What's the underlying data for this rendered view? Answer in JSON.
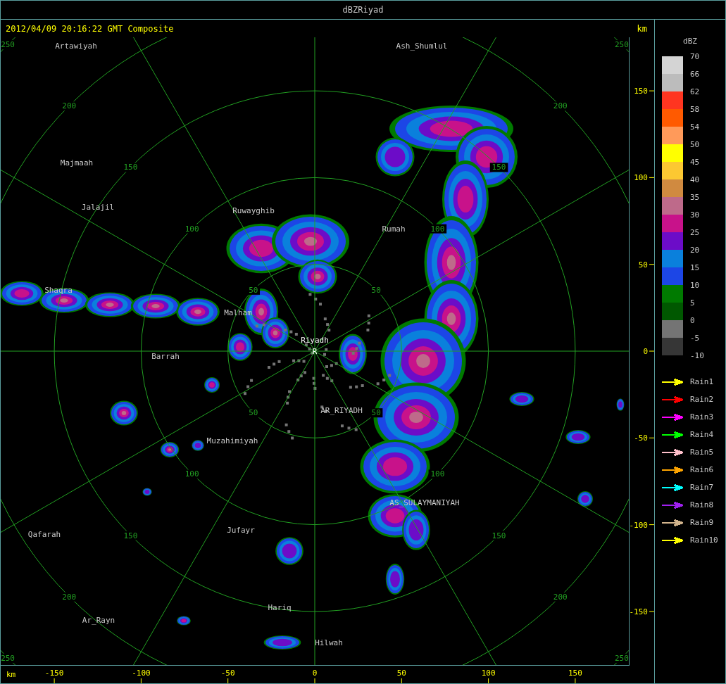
{
  "window": {
    "title": "dBZRiyad"
  },
  "header": {
    "timestamp": "2012/04/09 20:16:22 GMT Composite",
    "unit": "km"
  },
  "map": {
    "center_label": "Riyadh",
    "center_mark": "R",
    "places": [
      "Artawiyah",
      "Ash_Shumlul",
      "Majmaah",
      "Jalajil",
      "Ruwayghib",
      "Rumah",
      "Shaqra",
      "Malham",
      "Barrah",
      "AR_RIYADH",
      "Muzahimiyah",
      "AS_SULAYMANIYAH",
      "Qafarah",
      "Jufayr",
      "Hariq",
      "Ar_Rayn",
      "Hilwah"
    ],
    "ring_labels": [
      "50",
      "50",
      "50",
      "50",
      "100",
      "100",
      "100",
      "100",
      "150",
      "150",
      "150",
      "150",
      "200",
      "200",
      "200",
      "200",
      "250",
      "250",
      "250",
      "250"
    ]
  },
  "x_axis": {
    "unit": "km",
    "ticks": [
      "-150",
      "-100",
      "-50",
      "0",
      "50",
      "100",
      "150"
    ]
  },
  "y_axis": {
    "ticks": [
      "150",
      "100",
      "50",
      "0",
      "-50",
      "-100",
      "-150"
    ]
  },
  "legend": {
    "unit": "dBZ",
    "bottom_label": "-10",
    "bands": [
      {
        "label": "70",
        "color": "#d4d4d4"
      },
      {
        "label": "66",
        "color": "#bcbcbc"
      },
      {
        "label": "62",
        "color": "#ff3520"
      },
      {
        "label": "58",
        "color": "#ff5a00"
      },
      {
        "label": "54",
        "color": "#ff9a5a"
      },
      {
        "label": "50",
        "color": "#ffff00"
      },
      {
        "label": "45",
        "color": "#fcc832"
      },
      {
        "label": "40",
        "color": "#d08a40"
      },
      {
        "label": "35",
        "color": "#be6a8a"
      },
      {
        "label": "30",
        "color": "#c8128a"
      },
      {
        "label": "25",
        "color": "#6c0cc8"
      },
      {
        "label": "20",
        "color": "#0a80dc"
      },
      {
        "label": "15",
        "color": "#1c46e6"
      },
      {
        "label": "10",
        "color": "#007a00"
      },
      {
        "label": "5",
        "color": "#005800"
      },
      {
        "label": "0",
        "color": "#747474"
      },
      {
        "label": "-5",
        "color": "#363636"
      }
    ]
  },
  "tracks": [
    {
      "label": "Rain1",
      "color": "#ffff00"
    },
    {
      "label": "Rain2",
      "color": "#ff0000"
    },
    {
      "label": "Rain3",
      "color": "#ff00ff"
    },
    {
      "label": "Rain4",
      "color": "#00ff00"
    },
    {
      "label": "Rain5",
      "color": "#ffc0cb"
    },
    {
      "label": "Rain6",
      "color": "#ffa500"
    },
    {
      "label": "Rain7",
      "color": "#00ffff"
    },
    {
      "label": "Rain8",
      "color": "#a020f0"
    },
    {
      "label": "Rain9",
      "color": "#d2b48c"
    },
    {
      "label": "Rain10",
      "color": "#ffff00"
    }
  ]
}
